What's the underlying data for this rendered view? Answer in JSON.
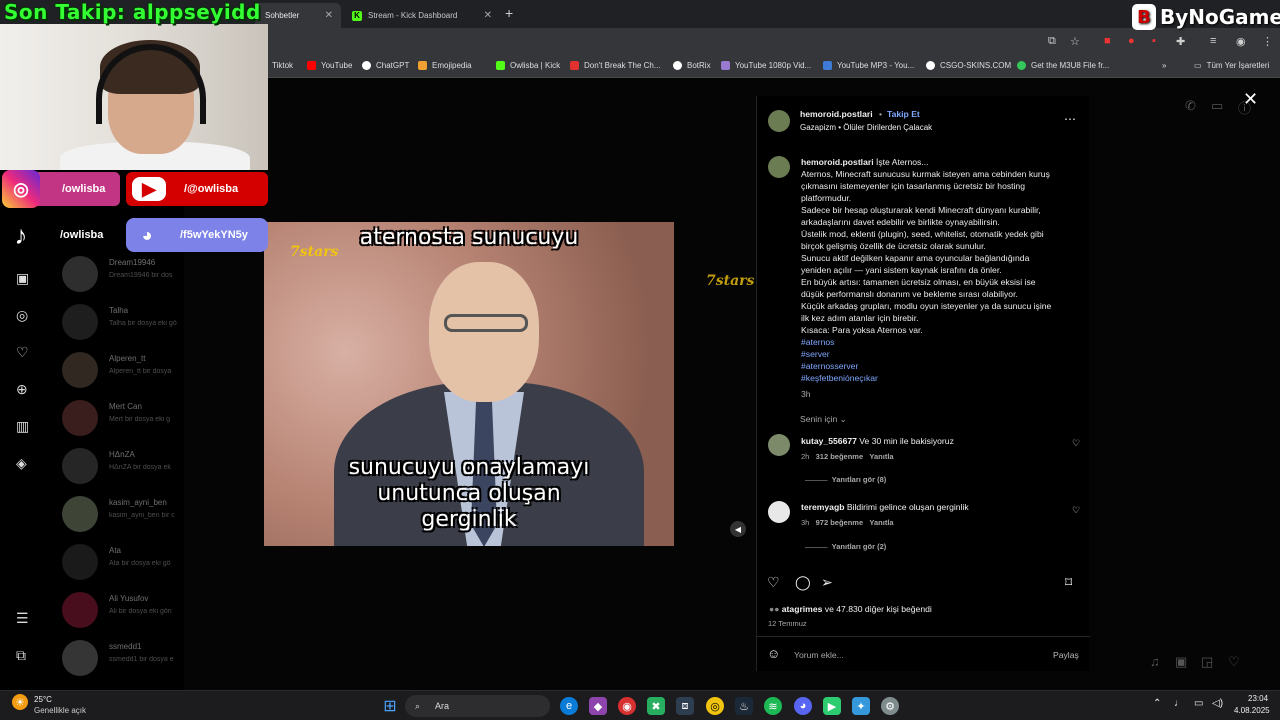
{
  "overlay": {
    "follow_text": "Son Takip: alppseyidd",
    "brand": "ByNoGame",
    "socials": [
      {
        "icon": "instagram-icon",
        "label": "/owlisba"
      },
      {
        "icon": "youtube-icon",
        "label": "/@owlisba"
      },
      {
        "icon": "tiktok-icon",
        "label": "/owlisba"
      },
      {
        "icon": "discord-icon",
        "label": "/f5wYekYN5y"
      }
    ]
  },
  "browser": {
    "tabs": [
      {
        "label": "Sohbetler",
        "active": false
      },
      {
        "label": "Stream - Kick Dashboard",
        "active": false
      }
    ],
    "bookmarks": [
      {
        "label": "Tiktok",
        "color": "#000000"
      },
      {
        "label": "YouTube",
        "color": "#ff0000"
      },
      {
        "label": "ChatGPT",
        "color": "#ffffff"
      },
      {
        "label": "Emojipedia",
        "color": "#f0a030"
      },
      {
        "label": "Owlisba | Kick",
        "color": "#53fc18"
      },
      {
        "label": "Don't Break The Ch...",
        "color": "#e03030"
      },
      {
        "label": "BotRix",
        "color": "#ffffff"
      },
      {
        "label": "YouTube 1080p Vid...",
        "color": "#9a7ad0"
      },
      {
        "label": "YouTube MP3 - You...",
        "color": "#3d7bd6"
      },
      {
        "label": "CSGO-SKINS.COM",
        "color": "#ffffff"
      },
      {
        "label": "Get the M3U8 File fr...",
        "color": "#34c759"
      }
    ],
    "all_bookmarks": "Tüm Yer İşaretleri"
  },
  "dm_list": [
    {
      "name": "Dream19946",
      "sub": "Dream19946 bir dos"
    },
    {
      "name": "Talha",
      "sub": "Talha bir dosya eki gö"
    },
    {
      "name": "Alperen_tt",
      "sub": "Alperen_tt bir dosya"
    },
    {
      "name": "Mert Can",
      "sub": "Mert bir dosya eki g"
    },
    {
      "name": "HΔnZA",
      "sub": "HΔnZA bir dosya ek"
    },
    {
      "name": "kasim_ayni_ben",
      "sub": "kasim_ayni_ben bir c"
    },
    {
      "name": "Ata",
      "sub": "Ata bir dosya eki gö"
    },
    {
      "name": "Ali Yusufov",
      "sub": "Ali bir dosya eki gön"
    },
    {
      "name": "ssmedd1",
      "sub": "ssmedd1 bir dosya e"
    }
  ],
  "video": {
    "top_caption": "aternosta sunucuyu",
    "bottom_caption": [
      "sunucuyu onaylamayı",
      "unutunca oluşan",
      "gerginlik"
    ],
    "logo": "7stars"
  },
  "post": {
    "username": "hemoroid.postlari",
    "follow": "Takip Et",
    "audio": "Gazapizm • Ölüler Dirilerden Çalacak",
    "caption_head": "İşte Aternos...",
    "caption_lines": [
      "Aternos, Minecraft sunucusu kurmak isteyen ama cebinden kuruş",
      "çıkmasını istemeyenler için tasarlanmış ücretsiz bir hosting",
      "platformudur.",
      "Sadece bir hesap oluşturarak kendi Minecraft dünyanı kurabilir,",
      "arkadaşlarını davet edebilir ve birlikte oynayabilirsin.",
      "Üstelik mod, eklenti (plugin), seed, whitelist, otomatik yedek gibi",
      "birçok gelişmiş özellik de ücretsiz olarak sunulur.",
      "Sunucu aktif değilken kapanır ama oyuncular bağlandığında",
      "yeniden açılır — yani sistem kaynak israfını da önler.",
      "En büyük artısı: tamamen ücretsiz olması, en büyük eksisi ise",
      "düşük performanslı donanım ve bekleme sırası olabiliyor.",
      "Küçük arkadaş grupları, modlu oyun isteyenler ya da sunucu işine",
      "ilk kez adım atanlar için birebir.",
      "Kısaca: Para yoksa Aternos var."
    ],
    "hashtags": [
      "#aternos",
      "#server",
      "#aternosserver",
      "#keşfetbenióneçıkar"
    ],
    "time": "3h",
    "sort": "Senin için",
    "comments": [
      {
        "user": "kutay_556677",
        "text": "Ve 30 min ile bakisiyoruz",
        "time": "2h",
        "likes": "312 beğenme",
        "reply": "Yanıtla",
        "view_replies": "Yanıtları gör (8)"
      },
      {
        "user": "teremyagb",
        "text": "Bildirimi gelince oluşan gerginlik",
        "time": "3h",
        "likes": "972 beğenme",
        "reply": "Yanıtla",
        "view_replies": "Yanıtları gör (2)"
      }
    ],
    "liked_by_user": "atagrimes",
    "liked_by_rest": " ve 47.830 diğer kişi",
    "liked_suffix": " beğendi",
    "date": "12 Temmuz",
    "comment_placeholder": "Yorum ekle...",
    "share": "Paylaş"
  },
  "taskbar": {
    "weather_temp": "25°C",
    "weather_desc": "Genellikle açık",
    "search": "Ara",
    "time": "23:04",
    "date": "4.08.2025"
  }
}
